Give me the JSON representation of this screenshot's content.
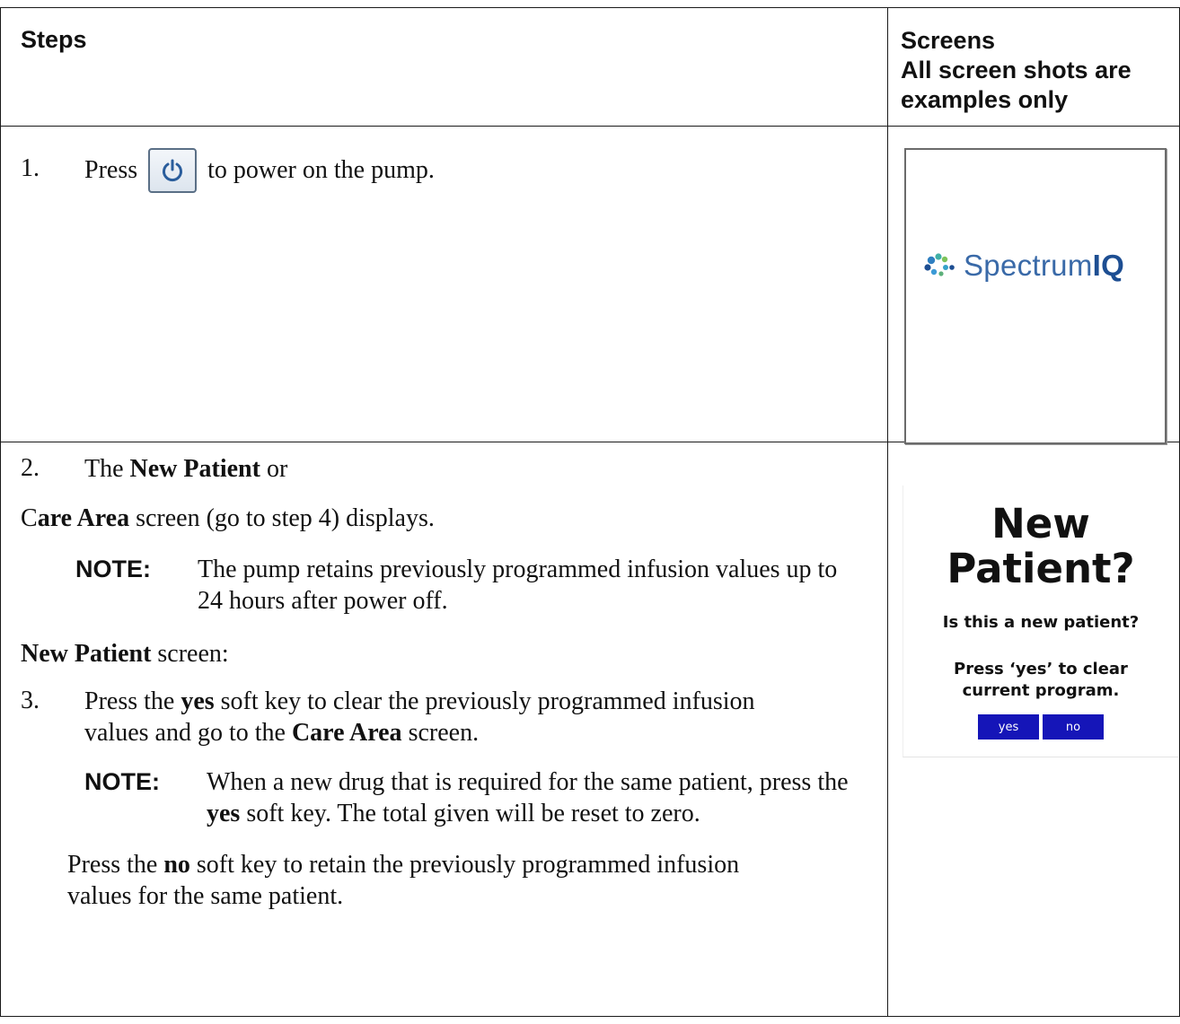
{
  "header": {
    "steps": "Steps",
    "screens_line1": "Screens",
    "screens_line2": "All screen shots are",
    "screens_line3": "examples only"
  },
  "step1": {
    "number": "1.",
    "before": "Press",
    "icon": "power-icon",
    "after": "to power on the pump."
  },
  "splash_screen": {
    "logo_text_regular": "Spectrum",
    "logo_text_bold": "IQ"
  },
  "step2": {
    "number": "2.",
    "text_a": "The",
    "bold_a": "New Patient",
    "text_b": "or",
    "text_c": "C",
    "bold_c": "are Area",
    "text_d": "screen (go to step 4) displays."
  },
  "note1": {
    "label": "NOTE:",
    "text": "The pump retains previously programmed infusion values up to 24 hours after power off."
  },
  "subheading": {
    "bold": "New Patient",
    "text": "screen:"
  },
  "step3": {
    "number": "3.",
    "t1": "Press the",
    "b1": "yes",
    "t2": "soft key to clear the previously programmed infusion values and go to the",
    "b2": "Care Area",
    "t3": "screen."
  },
  "note2": {
    "label": "NOTE:",
    "t1": "When a new drug that is required for the same patient, press the",
    "b1": "yes",
    "t2": "soft key. The total given will be reset to zero."
  },
  "step3_alt": {
    "t1": "Press the",
    "b1": "no",
    "t2": "soft key to retain the previously programmed infusion values for the same patient."
  },
  "new_patient_screen": {
    "title_line1": "New",
    "title_line2": "Patient?",
    "question": "Is this a new patient?",
    "hint_line1": "Press ‘yes’ to clear",
    "hint_line2": "current program.",
    "yes_label": "yes",
    "no_label": "no",
    "softkey_color": "#1515b8"
  }
}
